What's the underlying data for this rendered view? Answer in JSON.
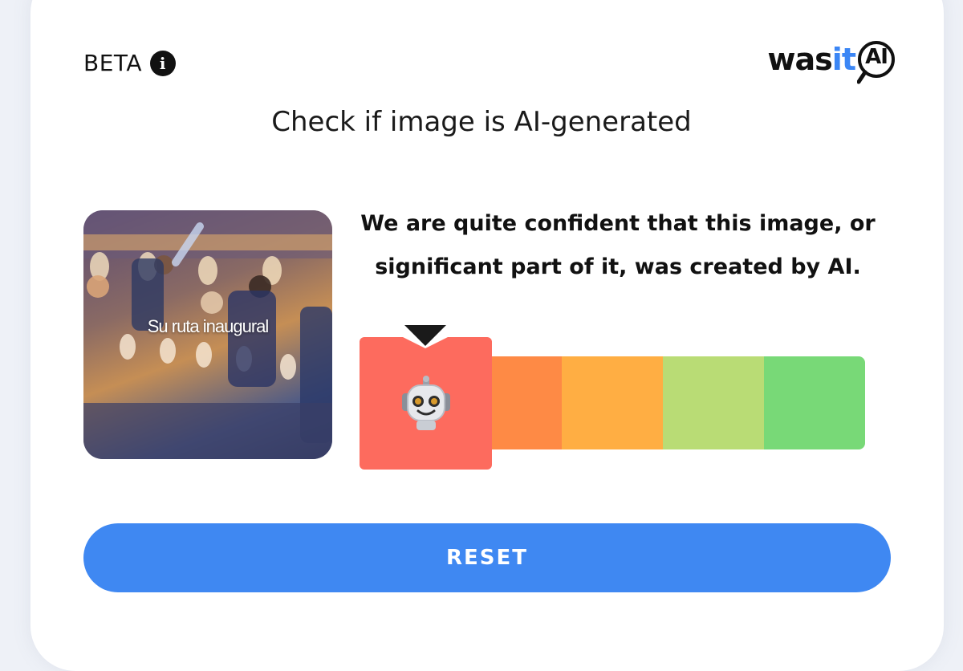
{
  "header": {
    "beta_label": "BETA",
    "info_icon": "info-icon",
    "logo": {
      "part1": "wasit",
      "part1a": "was",
      "part1b": "it",
      "part2": "AI"
    }
  },
  "title": "Check if image is AI-generated",
  "thumbnail": {
    "caption": "Su ruta inaugural"
  },
  "result": {
    "message": "We are quite confident that this image, or significant part of it, was created by AI.",
    "selected_level": 1,
    "level_count": 5,
    "robot_icon": "robot-icon",
    "colors": [
      "#fd6b5e",
      "#fe8a45",
      "#ffae43",
      "#b9dc75",
      "#78d977"
    ]
  },
  "reset_label": "RESET"
}
